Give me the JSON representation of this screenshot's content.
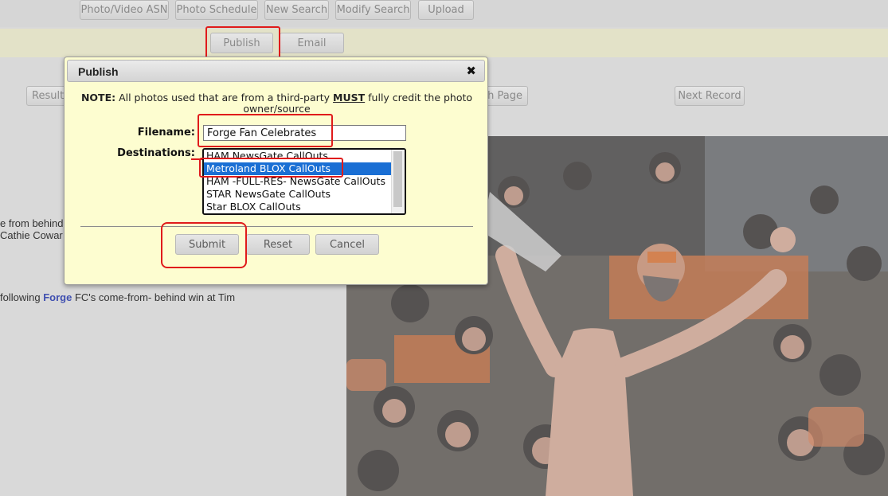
{
  "toolbar": {
    "photo_video_asn": "Photo/Video ASN",
    "photo_schedule": "Photo Schedule",
    "new_search": "New Search",
    "modify_search": "Modify Search",
    "upload": "Upload",
    "publish": "Publish",
    "email": "Email"
  },
  "nav": {
    "result": "Result",
    "page_partial": "h Page",
    "next_record": "Next Record"
  },
  "background_text": {
    "line1": "e from behind",
    "line2": "Cathie Cowar",
    "caption_before": " following ",
    "caption_highlight": "Forge",
    "caption_after": " FC's come-from- behind win at Tim"
  },
  "dialog": {
    "title": "Publish",
    "close_glyph": "✖",
    "note_label": "NOTE:",
    "note_text_1": " All photos used that are from a third-party ",
    "note_must": "MUST",
    "note_text_2": " fully credit the photo owner/source",
    "filename_label": "Filename:",
    "filename_value": "Forge Fan Celebrates",
    "destinations_label": "Destinations:",
    "destinations": [
      "HAM NewsGate CallOuts",
      "Metroland BLOX CallOuts",
      "HAM -FULL-RES- NewsGate CallOuts",
      "STAR NewsGate CallOuts",
      "Star BLOX CallOuts"
    ],
    "selected_destination": "Metroland BLOX CallOuts",
    "submit": "Submit",
    "reset": "Reset",
    "cancel": "Cancel"
  },
  "colors": {
    "annotation_red": "#e01b1b",
    "selection_blue": "#1a6fd4",
    "dialog_bg": "#fdfdd0"
  }
}
